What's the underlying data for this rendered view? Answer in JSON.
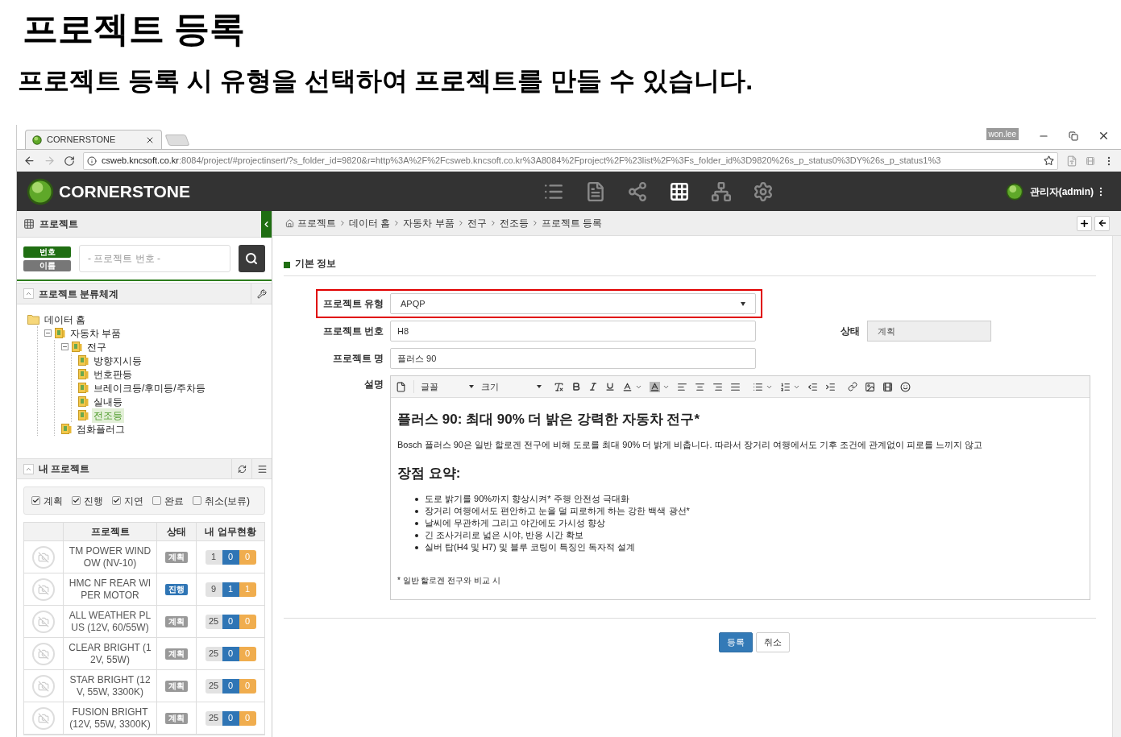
{
  "page": {
    "title": "프로젝트 등록",
    "subtitle": "프로젝트 등록 시 유형을 선택하여 프로젝트를 만들 수 있습니다."
  },
  "browser": {
    "tab_title": "CORNERSTONE",
    "profile": "won.lee",
    "url_host": "csweb.kncsoft.co.kr",
    "url_rest": ":8084/project/#projectinsert/?s_folder_id=9820&r=http%3A%2F%2Fcsweb.kncsoft.co.kr%3A8084%2Fproject%2F%23list%2F%3Fs_folder_id%3D9820%26s_p_status0%3DY%26s_p_status1%3"
  },
  "app": {
    "brand": "CORNERSTONE",
    "nav": [
      {
        "kind": "list",
        "selected": false
      },
      {
        "kind": "document",
        "selected": false
      },
      {
        "kind": "share",
        "selected": false
      },
      {
        "kind": "grid",
        "selected": true
      },
      {
        "kind": "hierarchy",
        "selected": false
      },
      {
        "kind": "settings",
        "selected": false
      }
    ],
    "user": "관리자(admin)"
  },
  "sidebar": {
    "title": "프로젝트",
    "search_modes": [
      {
        "label": "번호",
        "selected": true
      },
      {
        "label": "이름",
        "selected": false
      }
    ],
    "search": {
      "placeholder": "- 프로젝트 번호 -"
    },
    "tree_title": "프로젝트 분류체계",
    "tree": [
      {
        "label": "데이터 홈",
        "kind": "folder",
        "selected": false,
        "children": [
          {
            "label": "자동차 부품",
            "kind": "project",
            "selected": false,
            "expanded": true,
            "children": [
              {
                "label": "전구",
                "kind": "project",
                "selected": false,
                "expanded": true,
                "children": [
                  {
                    "label": "방향지시등",
                    "kind": "project",
                    "selected": false
                  },
                  {
                    "label": "번호판등",
                    "kind": "project",
                    "selected": false
                  },
                  {
                    "label": "브레이크등/후미등/주차등",
                    "kind": "project",
                    "selected": false
                  },
                  {
                    "label": "실내등",
                    "kind": "project",
                    "selected": false
                  },
                  {
                    "label": "전조등",
                    "kind": "project",
                    "selected": true
                  }
                ]
              },
              {
                "label": "점화플러그",
                "kind": "project",
                "selected": false
              }
            ]
          }
        ]
      }
    ],
    "my_projects": {
      "title": "내 프로젝트",
      "filters": [
        {
          "label": "계획",
          "checked": true
        },
        {
          "label": "진행",
          "checked": true
        },
        {
          "label": "지연",
          "checked": true
        },
        {
          "label": "완료",
          "checked": false
        },
        {
          "label": "취소(보류)",
          "checked": false
        }
      ],
      "columns": [
        "프로젝트",
        "상태",
        "내 업무현황"
      ],
      "rows": [
        {
          "name": "TM POWER WINDOW (NV-10)",
          "status": "계획",
          "color": "#999999",
          "counts": [
            "1",
            "0",
            "0"
          ]
        },
        {
          "name": "HMC NF REAR WIPER MOTOR",
          "status": "진행",
          "color": "#2f75b5",
          "counts": [
            "9",
            "1",
            "1"
          ]
        },
        {
          "name": "ALL WEATHER PLUS (12V, 60/55W)",
          "status": "계획",
          "color": "#999999",
          "counts": [
            "25",
            "0",
            "0"
          ]
        },
        {
          "name": "CLEAR BRIGHT (12V, 55W)",
          "status": "계획",
          "color": "#999999",
          "counts": [
            "25",
            "0",
            "0"
          ]
        },
        {
          "name": "STAR BRIGHT (12V, 55W, 3300K)",
          "status": "계획",
          "color": "#999999",
          "counts": [
            "25",
            "0",
            "0"
          ]
        },
        {
          "name": "FUSION BRIGHT (12V, 55W, 3300K)",
          "status": "계획",
          "color": "#999999",
          "counts": [
            "25",
            "0",
            "0"
          ]
        }
      ]
    }
  },
  "main": {
    "breadcrumb": [
      "프로젝트",
      "데이터 홈",
      "자동차 부품",
      "전구",
      "전조등",
      "프로젝트 등록"
    ],
    "section_title": "기본 정보",
    "type": {
      "label": "프로젝트 유형",
      "value": "APQP",
      "highlighted": true
    },
    "number": {
      "label": "프로젝트 번호",
      "value": "H8"
    },
    "status": {
      "label": "상태",
      "value": "계획",
      "disabled": true
    },
    "name": {
      "label": "프로젝트 명",
      "value": "플러스 90"
    },
    "description": {
      "label": "설명",
      "font_select": "글꼴",
      "size_select": "크기",
      "heading": "플러스 90: 최대 90% 더 밝은 강력한 자동차 전구*",
      "paragraph": "Bosch 플러스 90은 일반 할로겐 전구에 비해 도로를 최대 90% 더 밝게 비춥니다. 따라서 장거리 여행에서도 기후 조건에 관계없이 피로를 느끼지 않고",
      "subheading": "장점 요약:",
      "bullets": [
        "도로 밝기를 90%까지 향상시켜* 주행 안전성 극대화",
        "장거리 여행에서도 편안하고 눈을 덜 피로하게 하는 강한 백색 광선*",
        "날씨에 무관하게 그리고 야간에도 가시성 향상",
        "긴 조사거리로 넓은 시야, 반응 시간 확보",
        "실버 탑(H4 및 H7) 및 블루 코팅이 특징인 독자적 설계"
      ],
      "footnote": "* 일반 할로겐 전구와 비교 시"
    },
    "buttons": [
      {
        "label": "등록",
        "kind": "primary"
      },
      {
        "label": "취소",
        "kind": "default"
      }
    ]
  }
}
